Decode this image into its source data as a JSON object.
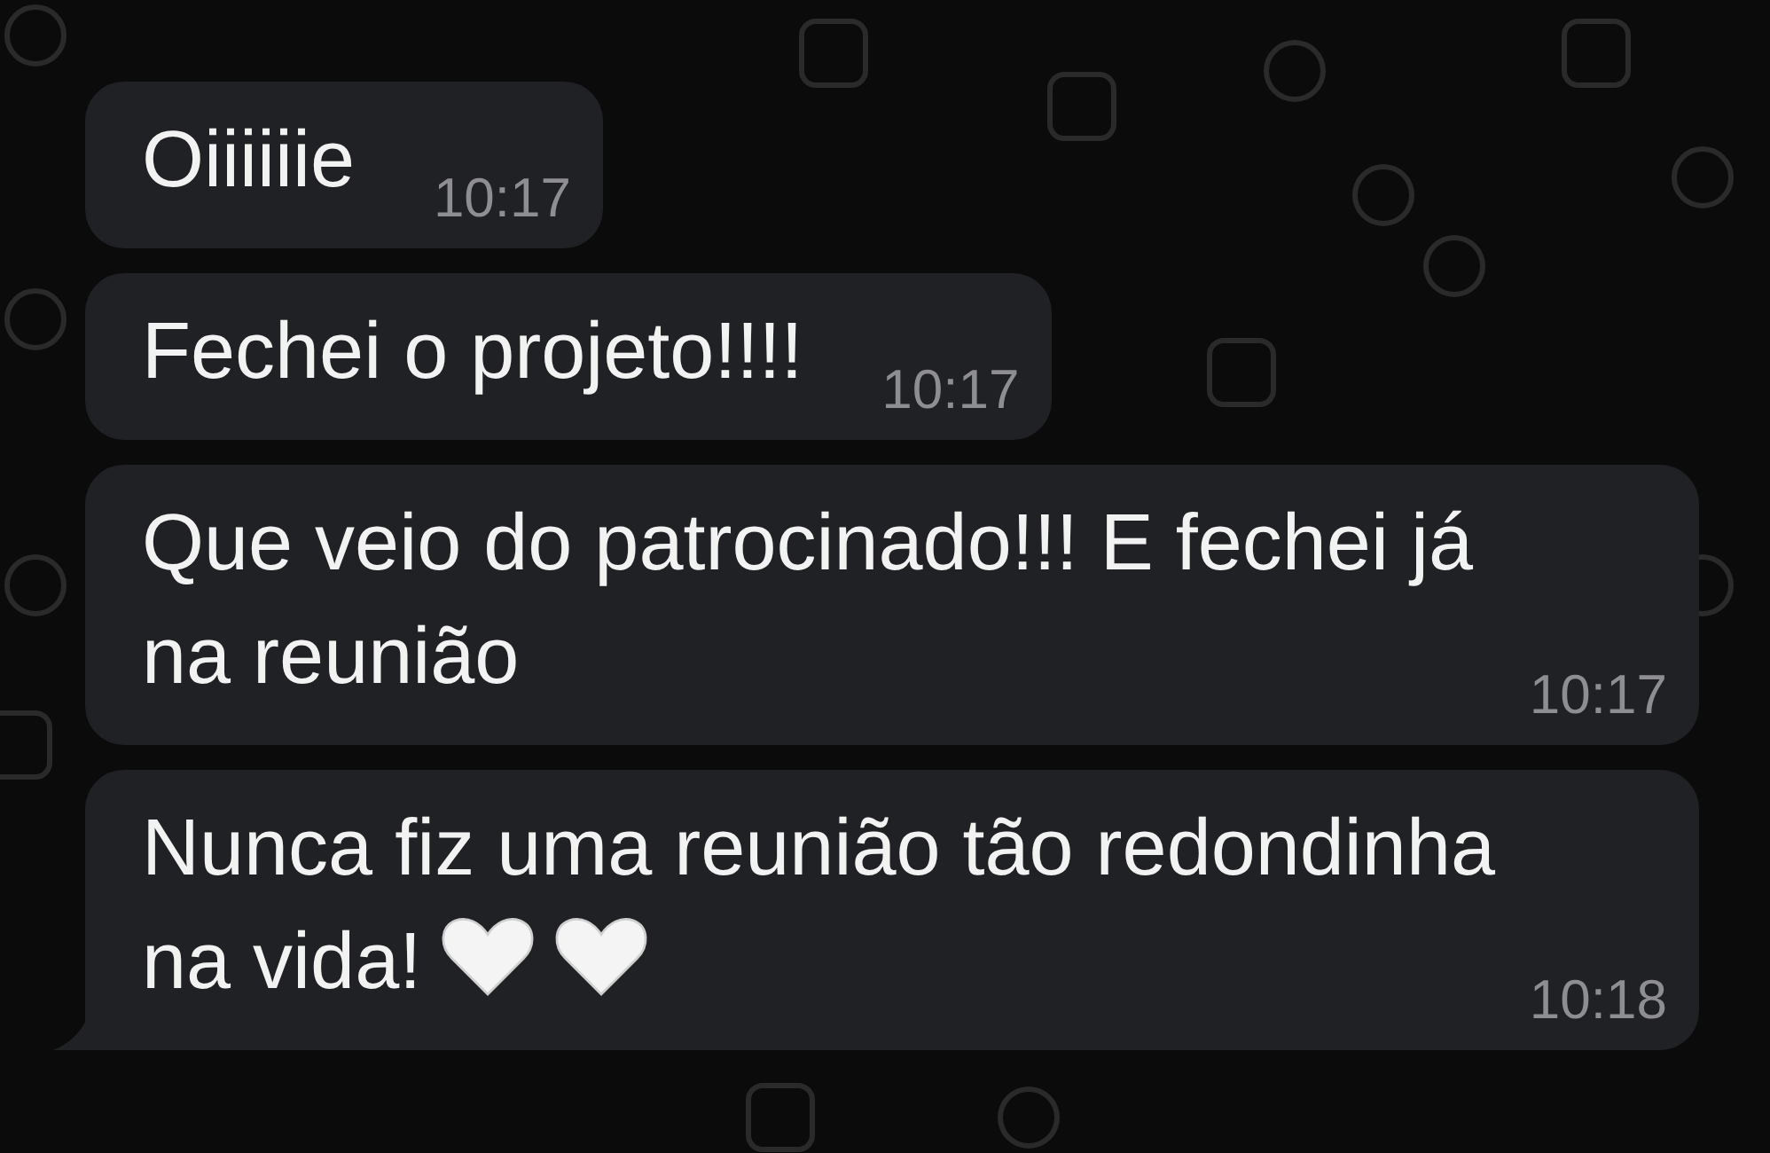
{
  "messages": [
    {
      "text": "Oiiiiiie",
      "time": "10:17",
      "tail": false
    },
    {
      "text": "Fechei o projeto!!!!",
      "time": "10:17",
      "tail": false
    },
    {
      "text": "Que veio do patrocinado!!! E fechei já na reunião",
      "time": "10:17",
      "tail": false
    },
    {
      "text": "Nunca fiz uma reunião tão redondinha na vida!",
      "emojis": [
        {
          "kind": "heart"
        },
        {
          "kind": "heart"
        }
      ],
      "time": "10:18",
      "tail": true
    }
  ]
}
